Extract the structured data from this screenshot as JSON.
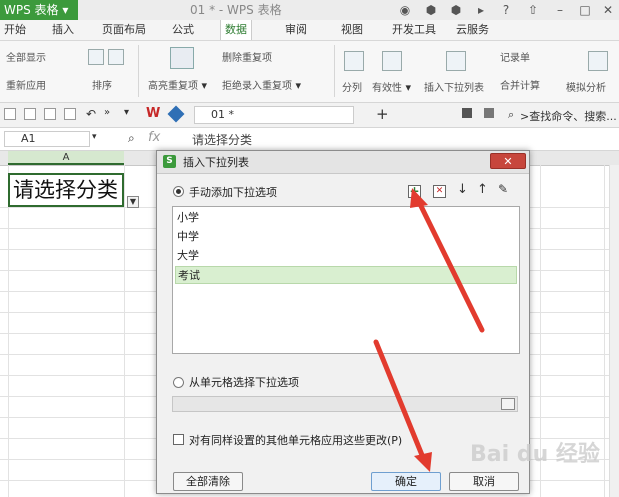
{
  "app": {
    "name": "WPS 表格",
    "doc_title": "01 * - WPS 表格"
  },
  "menu_tabs": [
    "开始",
    "插入",
    "页面布局",
    "公式",
    "数据",
    "审阅",
    "视图",
    "开发工具",
    "云服务"
  ],
  "active_tab": "数据",
  "ribbon": {
    "show_all": "全部显示",
    "reapply": "重新应用",
    "sort": "排序",
    "highlight_dup": "高亮重复项",
    "delete_dup": "删除重复项",
    "reject_dup": "拒绝录入重复项",
    "split": "分列",
    "validity": "有效性",
    "insert_dropdown": "插入下拉列表",
    "record": "记录单",
    "merge_calc": "合并计算",
    "simulate": "模拟分析"
  },
  "quickbar": {
    "doc_tab": "01 *",
    "search_placeholder": "查找命令、搜索..."
  },
  "formula_bar": {
    "cell_ref": "A1",
    "fx": "fx",
    "content": "请选择分类"
  },
  "sheet": {
    "col_a": "A",
    "cell_a1": "请选择分类"
  },
  "dialog": {
    "title": "插入下拉列表",
    "close": "✕",
    "option_manual": "手动添加下拉选项",
    "option_cells": "从单元格选择下拉选项",
    "items": [
      "小学",
      "中学",
      "大学",
      "考试"
    ],
    "selected_index": 3,
    "apply_checkbox": "对有同样设置的其他单元格应用这些更改(P)",
    "clear_all": "全部清除",
    "ok": "确定",
    "cancel": "取消"
  },
  "watermark": "Bai du 经验",
  "colors": {
    "accent_green": "#3c9a3c",
    "arrow_red": "#e23b2e"
  }
}
